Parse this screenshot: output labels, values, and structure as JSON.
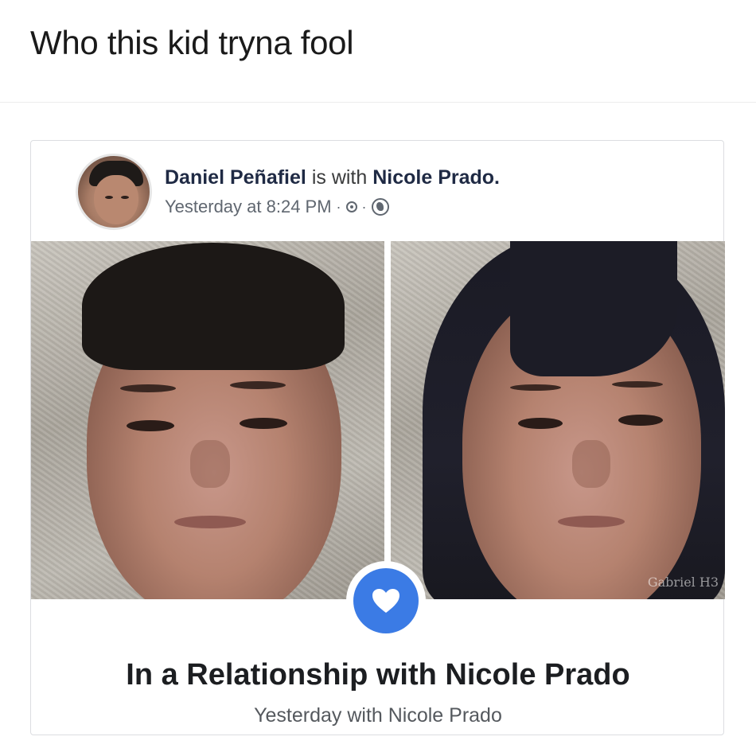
{
  "caption": "Who this kid tryna fool",
  "post": {
    "author": "Daniel Peñafiel",
    "with_text": "is with",
    "tagged": "Nicole Prado.",
    "timestamp": "Yesterday at 8:24 PM",
    "separator": "·",
    "icons": [
      "clock-icon",
      "globe-icon"
    ]
  },
  "photos": {
    "left": {
      "subject": "boy-selfie"
    },
    "right": {
      "subject": "girl-filter-selfie",
      "watermark": "Gabriel H3"
    }
  },
  "life_event": {
    "icon": "heart-icon",
    "accent_color": "#3b7be5",
    "title": "In a Relationship with Nicole Prado",
    "subtitle": "Yesterday with Nicole Prado"
  }
}
